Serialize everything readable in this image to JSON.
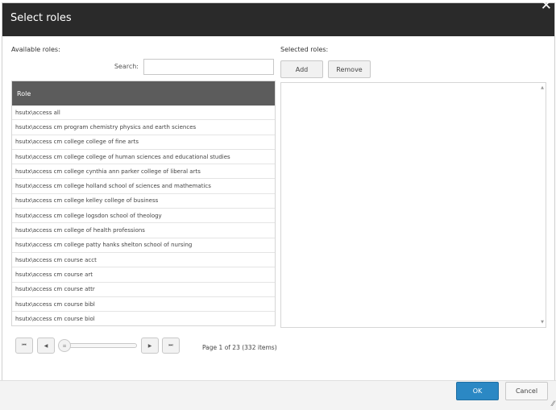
{
  "dialog": {
    "title": "Select roles",
    "close_glyph": "✕"
  },
  "available": {
    "label": "Available roles:",
    "search_label": "Search:",
    "search_value": ""
  },
  "selected": {
    "label": "Selected roles:",
    "add_label": "Add",
    "remove_label": "Remove"
  },
  "grid": {
    "column": "Role",
    "rows": [
      "hsutx\\access all",
      "hsutx\\access cm program chemistry physics and earth sciences",
      "hsutx\\access cm college college of fine arts",
      "hsutx\\access cm college college of human sciences and educational studies",
      "hsutx\\access cm college cynthia ann parker college of liberal arts",
      "hsutx\\access cm college holland school of sciences and mathematics",
      "hsutx\\access cm college kelley college of business",
      "hsutx\\access cm college logsdon school of theology",
      "hsutx\\access cm college of health professions",
      "hsutx\\access cm college patty hanks shelton school of nursing",
      "hsutx\\access cm course acct",
      "hsutx\\access cm course art",
      "hsutx\\access cm course attr",
      "hsutx\\access cm course bibl",
      "hsutx\\access cm course biol"
    ]
  },
  "pager": {
    "first_glyph": "⏮",
    "prev_glyph": "◀",
    "next_glyph": "▶",
    "last_glyph": "⏭",
    "thumb_glyph": "≡",
    "info": "Page 1 of 23 (332 items)"
  },
  "footer": {
    "ok_label": "OK",
    "cancel_label": "Cancel",
    "grip_glyph": "⁄⁄"
  },
  "colors": {
    "titlebar": "#2a2a2a",
    "grid_header": "#5c5c5c",
    "ok": "#2b88c4"
  }
}
